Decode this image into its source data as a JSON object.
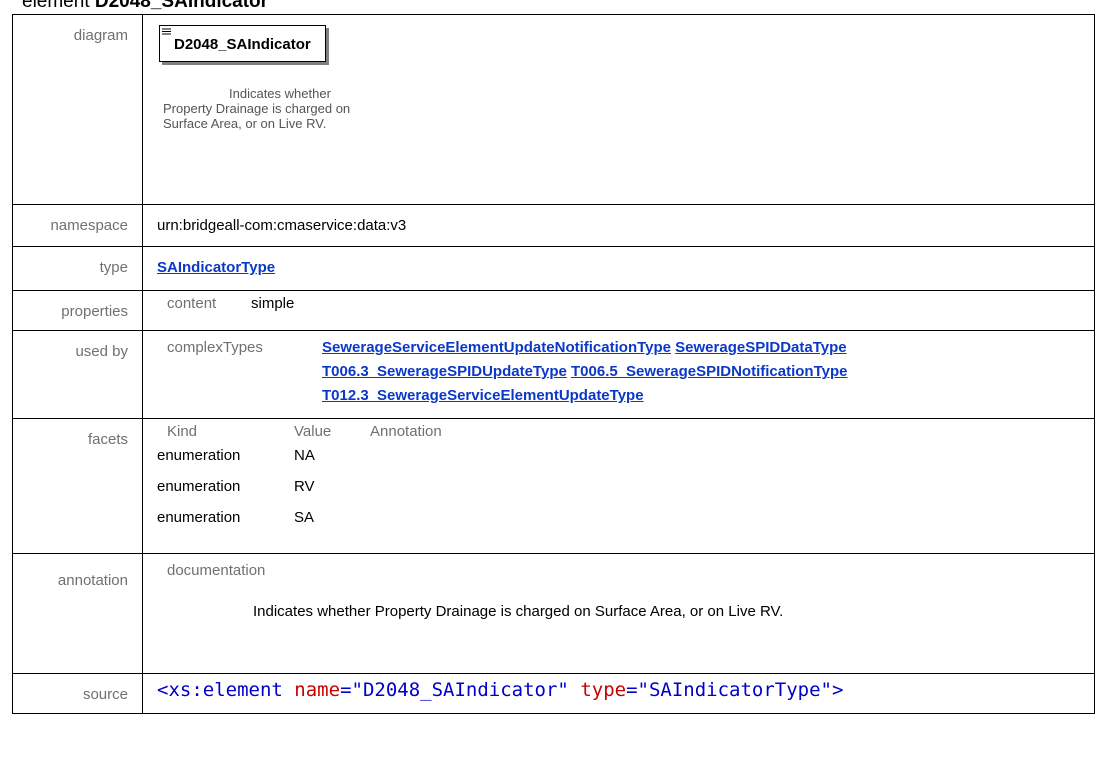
{
  "heading": {
    "prefix": "element ",
    "name": "D2048_SAIndicator"
  },
  "rows": {
    "diagram": {
      "label": "diagram",
      "element_name": "D2048_SAIndicator",
      "note": "Indicates whether Property Drainage is charged on Surface Area, or on Live RV."
    },
    "namespace": {
      "label": "namespace",
      "value": "urn:bridgeall-com:cmaservice:data:v3"
    },
    "type": {
      "label": "type",
      "value": "SAIndicatorType"
    },
    "properties": {
      "label": "properties",
      "key": "content",
      "value": "simple"
    },
    "used_by": {
      "label": "used by",
      "key": "complexTypes",
      "links": [
        "SewerageServiceElementUpdateNotificationType",
        "SewerageSPIDDataType",
        "T006.3_SewerageSPIDUpdateType",
        "T006.5_SewerageSPIDNotificationType",
        "T012.3_SewerageServiceElementUpdateType"
      ]
    },
    "facets": {
      "label": "facets",
      "headers": [
        "Kind",
        "Value",
        "Annotation"
      ],
      "items": [
        {
          "kind": "enumeration",
          "value": "NA"
        },
        {
          "kind": "enumeration",
          "value": "RV"
        },
        {
          "kind": "enumeration",
          "value": "SA"
        }
      ]
    },
    "annotation": {
      "label": "annotation",
      "key": "documentation",
      "text": "Indicates whether Property Drainage is charged on Surface Area, or on Live RV."
    },
    "source": {
      "label": "source",
      "tag_open": "<xs:element",
      "attr1": "name",
      "val1": "\"D2048_SAIndicator\"",
      "attr2": "type",
      "val2": "\"SAIndicatorType\"",
      "tag_close": ">"
    }
  }
}
